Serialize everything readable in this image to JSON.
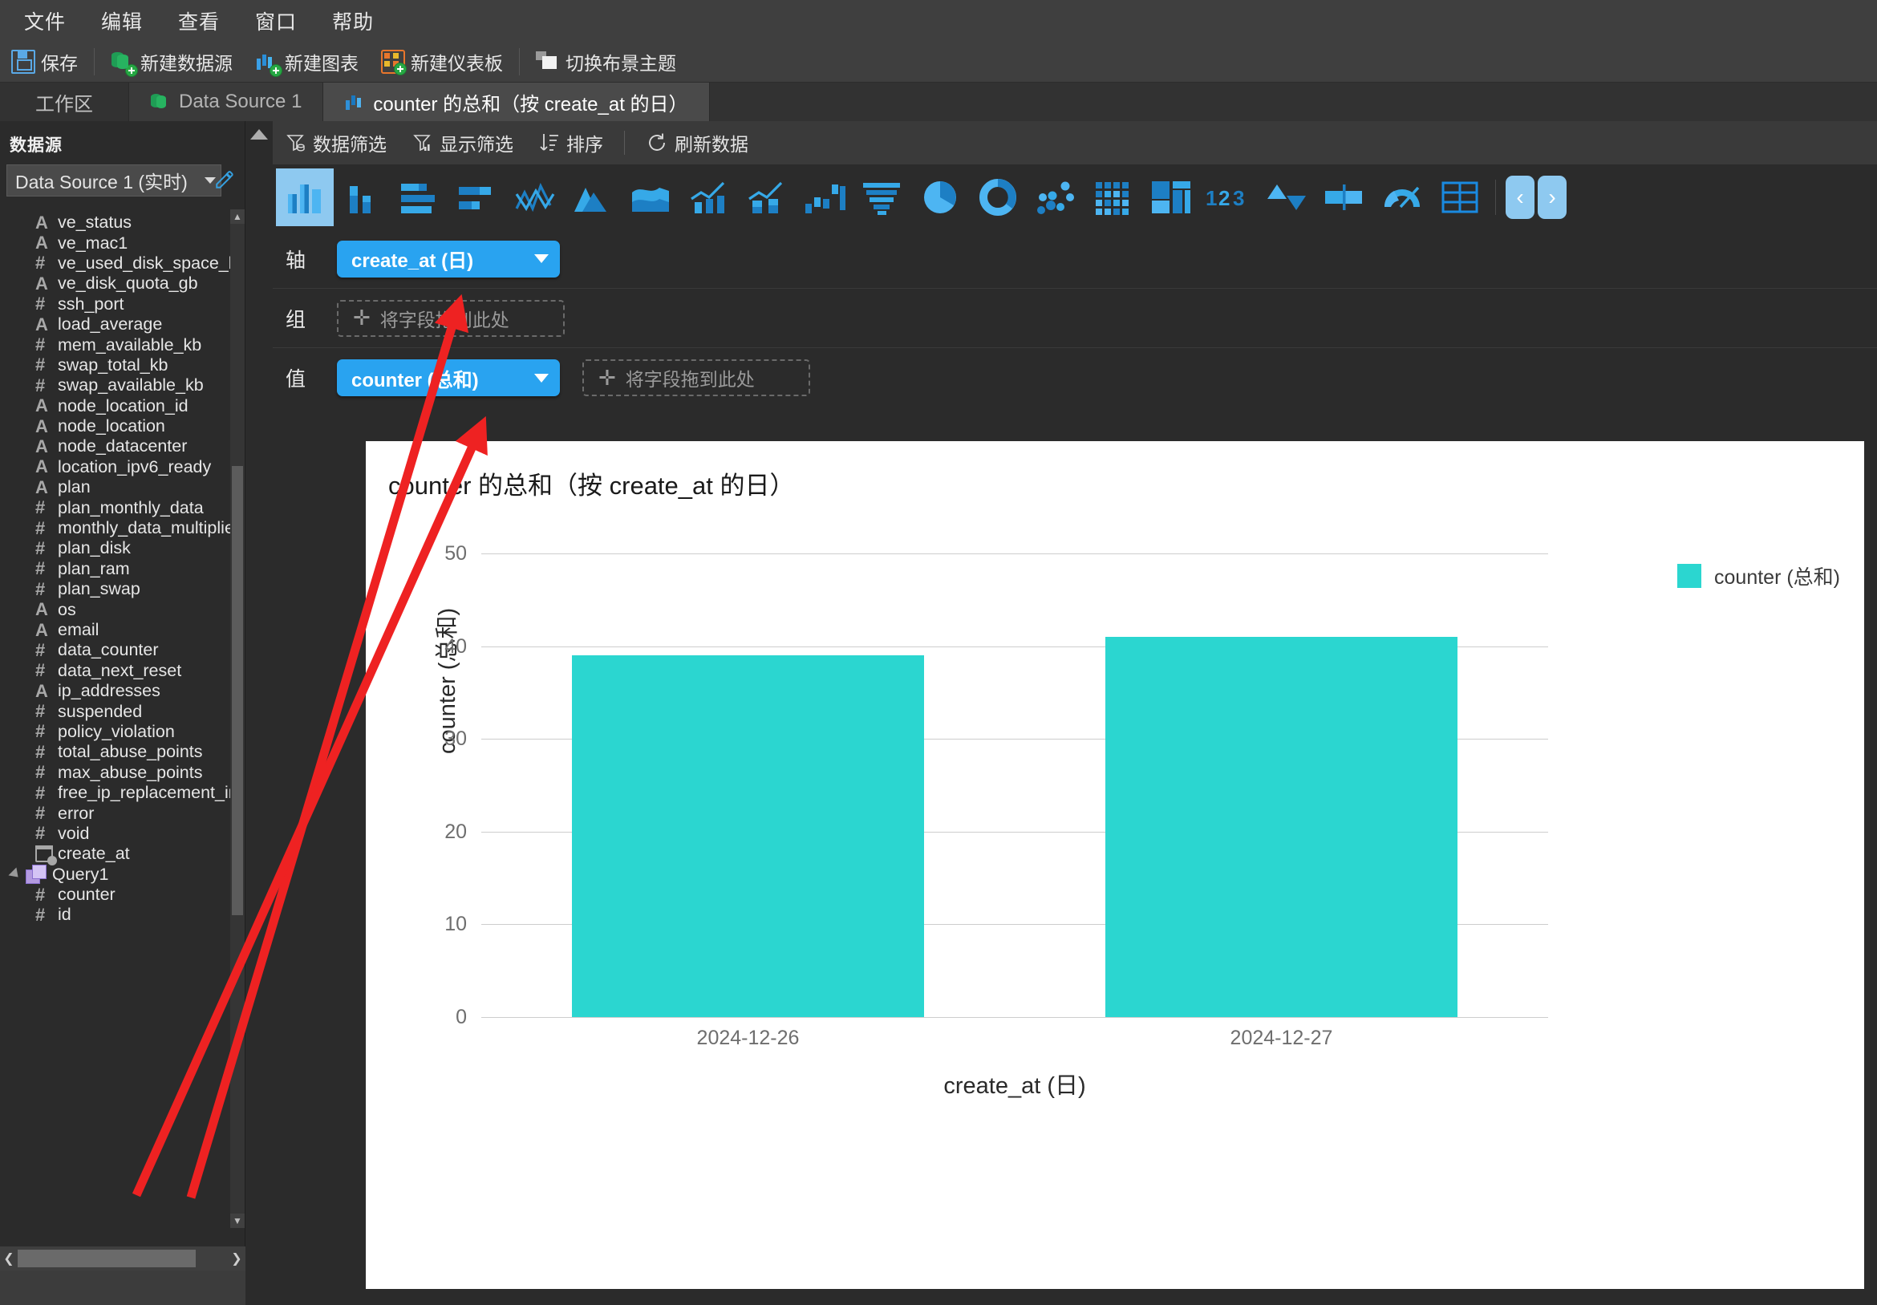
{
  "menubar": {
    "items": [
      {
        "label": "文件",
        "name": "menu-file"
      },
      {
        "label": "编辑",
        "name": "menu-edit"
      },
      {
        "label": "查看",
        "name": "menu-view"
      },
      {
        "label": "窗口",
        "name": "menu-window"
      },
      {
        "label": "帮助",
        "name": "menu-help"
      }
    ]
  },
  "toolbar": {
    "save_label": "保存",
    "new_datasource_label": "新建数据源",
    "new_chart_label": "新建图表",
    "new_dashboard_label": "新建仪表板",
    "switch_theme_label": "切换布景主题",
    "icons": [
      "save-icon",
      "new-datasource-icon",
      "new-chart-icon",
      "new-dashboard-icon",
      "switch-theme-icon"
    ]
  },
  "tabs": [
    {
      "label": "工作区",
      "name": "tab-workspace",
      "icon": "",
      "active": false
    },
    {
      "label": "Data Source 1",
      "name": "tab-data-source-1",
      "icon": "database-icon",
      "active": false
    },
    {
      "label": "counter 的总和（按 create_at 的日）",
      "name": "tab-chart",
      "icon": "bar-chart-icon",
      "active": true
    }
  ],
  "sidebar": {
    "title": "数据源",
    "datasource_selected": "Data Source 1 (实时)",
    "edit_icon": "pencil-icon",
    "fields": [
      {
        "type": "A",
        "name": "ve_status"
      },
      {
        "type": "A",
        "name": "ve_mac1"
      },
      {
        "type": "#",
        "name": "ve_used_disk_space_b"
      },
      {
        "type": "A",
        "name": "ve_disk_quota_gb"
      },
      {
        "type": "#",
        "name": "ssh_port"
      },
      {
        "type": "A",
        "name": "load_average"
      },
      {
        "type": "#",
        "name": "mem_available_kb"
      },
      {
        "type": "#",
        "name": "swap_total_kb"
      },
      {
        "type": "#",
        "name": "swap_available_kb"
      },
      {
        "type": "A",
        "name": "node_location_id"
      },
      {
        "type": "A",
        "name": "node_location"
      },
      {
        "type": "A",
        "name": "node_datacenter"
      },
      {
        "type": "A",
        "name": "location_ipv6_ready"
      },
      {
        "type": "A",
        "name": "plan"
      },
      {
        "type": "#",
        "name": "plan_monthly_data"
      },
      {
        "type": "#",
        "name": "monthly_data_multiplie"
      },
      {
        "type": "#",
        "name": "plan_disk"
      },
      {
        "type": "#",
        "name": "plan_ram"
      },
      {
        "type": "#",
        "name": "plan_swap"
      },
      {
        "type": "A",
        "name": "os"
      },
      {
        "type": "A",
        "name": "email"
      },
      {
        "type": "#",
        "name": "data_counter"
      },
      {
        "type": "#",
        "name": "data_next_reset"
      },
      {
        "type": "A",
        "name": "ip_addresses"
      },
      {
        "type": "#",
        "name": "suspended"
      },
      {
        "type": "#",
        "name": "policy_violation"
      },
      {
        "type": "#",
        "name": "total_abuse_points"
      },
      {
        "type": "#",
        "name": "max_abuse_points"
      },
      {
        "type": "#",
        "name": "free_ip_replacement_interv"
      },
      {
        "type": "#",
        "name": "error"
      },
      {
        "type": "#",
        "name": "void"
      },
      {
        "type": "date",
        "name": "create_at"
      },
      {
        "type": "query",
        "name": "Query1"
      },
      {
        "type": "#",
        "name": "counter",
        "child": true
      },
      {
        "type": "#",
        "name": "id",
        "child": true
      }
    ]
  },
  "chart_toolbar": {
    "data_filter_label": "数据筛选",
    "display_filter_label": "显示筛选",
    "sort_label": "排序",
    "refresh_label": "刷新数据",
    "icons": [
      "data-filter-icon",
      "display-filter-icon",
      "sort-icon",
      "refresh-icon"
    ]
  },
  "chart_types": [
    {
      "name": "column-chart",
      "selected": true
    },
    {
      "name": "grouped-column-chart",
      "selected": false
    },
    {
      "name": "bar-chart",
      "selected": false
    },
    {
      "name": "grouped-bar-chart",
      "selected": false
    },
    {
      "name": "line-chart",
      "selected": false
    },
    {
      "name": "area-chart",
      "selected": false
    },
    {
      "name": "stacked-area-chart",
      "selected": false
    },
    {
      "name": "combo-column-line-chart",
      "selected": false
    },
    {
      "name": "combo-stacked-line-chart",
      "selected": false
    },
    {
      "name": "waterfall-chart",
      "selected": false
    },
    {
      "name": "funnel-chart",
      "selected": false
    },
    {
      "name": "pie-chart",
      "selected": false
    },
    {
      "name": "donut-chart",
      "selected": false
    },
    {
      "name": "scatter-chart",
      "selected": false
    },
    {
      "name": "heatmap-chart",
      "selected": false
    },
    {
      "name": "treemap-chart",
      "selected": false
    },
    {
      "name": "number-card",
      "selected": false
    },
    {
      "name": "kpi-updown-card",
      "selected": false
    },
    {
      "name": "bullet-chart",
      "selected": false
    },
    {
      "name": "gauge-chart",
      "selected": false
    },
    {
      "name": "table-chart",
      "selected": false
    }
  ],
  "chart_nav": {
    "prev": "‹",
    "next": "›"
  },
  "shelves": [
    {
      "label": "轴",
      "name": "shelf-axis",
      "pill": "create_at (日)",
      "dropzone": null
    },
    {
      "label": "组",
      "name": "shelf-group",
      "pill": null,
      "dropzone": "将字段拖到此处"
    },
    {
      "label": "值",
      "name": "shelf-value",
      "pill": "counter (总和)",
      "dropzone": "将字段拖到此处"
    }
  ],
  "dropzone_placeholder": "将字段拖到此处",
  "colors": {
    "accent_blue": "#29a3f0",
    "bar_teal": "#2bd6d0",
    "panel_dark": "#2b2b2b",
    "annotation_red": "#ee2222"
  },
  "chart_data": {
    "type": "bar",
    "title": "counter 的总和（按 create_at 的日）",
    "categories": [
      "2024-12-26",
      "2024-12-27"
    ],
    "values": [
      39,
      41
    ],
    "series": [
      {
        "name": "counter (总和)",
        "values": [
          39,
          41
        ]
      }
    ],
    "xlabel": "create_at (日)",
    "ylabel": "counter (总和)",
    "ylim": [
      0,
      50
    ],
    "yticks": [
      0,
      10,
      20,
      30,
      40,
      50
    ],
    "grid": true,
    "legend": [
      "counter (总和)"
    ],
    "legend_position": "right",
    "bar_color": "#2bd6d0"
  }
}
